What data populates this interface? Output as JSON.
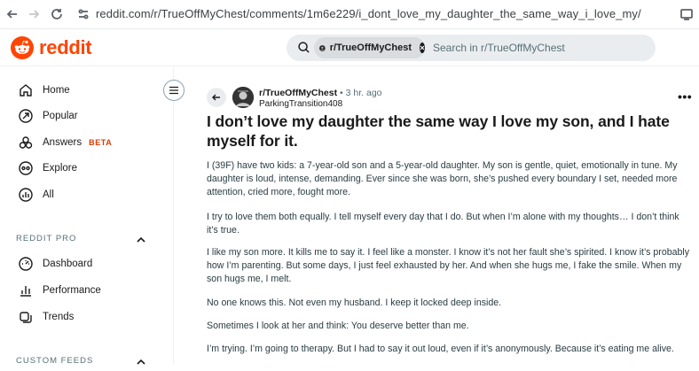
{
  "browser": {
    "url": "reddit.com/r/TrueOffMyChest/comments/1m6e229/i_dont_love_my_daughter_the_same_way_i_love_my/"
  },
  "header": {
    "logo_text": "reddit",
    "search": {
      "chip_label": "r/TrueOffMyChest",
      "placeholder": "Search in r/TrueOffMyChest"
    }
  },
  "sidebar": {
    "items": [
      {
        "label": "Home",
        "icon": "home-icon"
      },
      {
        "label": "Popular",
        "icon": "popular-icon"
      },
      {
        "label": "Answers",
        "badge": "BETA",
        "icon": "answers-icon"
      },
      {
        "label": "Explore",
        "icon": "explore-icon"
      },
      {
        "label": "All",
        "icon": "all-icon"
      }
    ],
    "reddit_pro": {
      "title": "REDDIT PRO",
      "items": [
        {
          "label": "Dashboard",
          "icon": "dashboard-icon"
        },
        {
          "label": "Performance",
          "icon": "performance-icon"
        },
        {
          "label": "Trends",
          "icon": "trends-icon"
        }
      ]
    },
    "custom_feeds": {
      "title": "CUSTOM FEEDS"
    }
  },
  "post": {
    "subreddit": "r/TrueOffMyChest",
    "separator": "•",
    "time": "3 hr. ago",
    "author": "ParkingTransition408",
    "more": "•••",
    "title": "I don’t love my daughter the same way I love my son, and I hate myself for it.",
    "paragraphs": [
      "I (39F) have two kids: a 7-year-old son and a 5-year-old daughter. My son is gentle, quiet, emotionally in tune. My daughter is loud, intense, demanding. Ever since she was born, she’s pushed every boundary I set, needed more attention, cried more, fought more.",
      "I try to love them both equally. I tell myself every day that I do. But when I’m alone with my thoughts… I don’t think it’s true.",
      "I like my son more. It kills me to say it. I feel like a monster. I know it’s not her fault she’s spirited. I know it’s probably how I’m parenting. But some days, I just feel exhausted by her. And when she hugs me, I fake the smile. When my son hugs me, I melt.",
      "No one knows this. Not even my husband. I keep it locked deep inside.",
      "Sometimes I look at her and think: You deserve better than me.",
      "I’m trying. I’m going to therapy. But I had to say it out loud, even if it’s anonymously. Because it’s eating me alive."
    ]
  },
  "colors": {
    "brand": "#ff4500",
    "beta": "#d93a00",
    "text": "#1a1a1b",
    "muted": "#576f76",
    "search_bg": "#eaedef"
  }
}
